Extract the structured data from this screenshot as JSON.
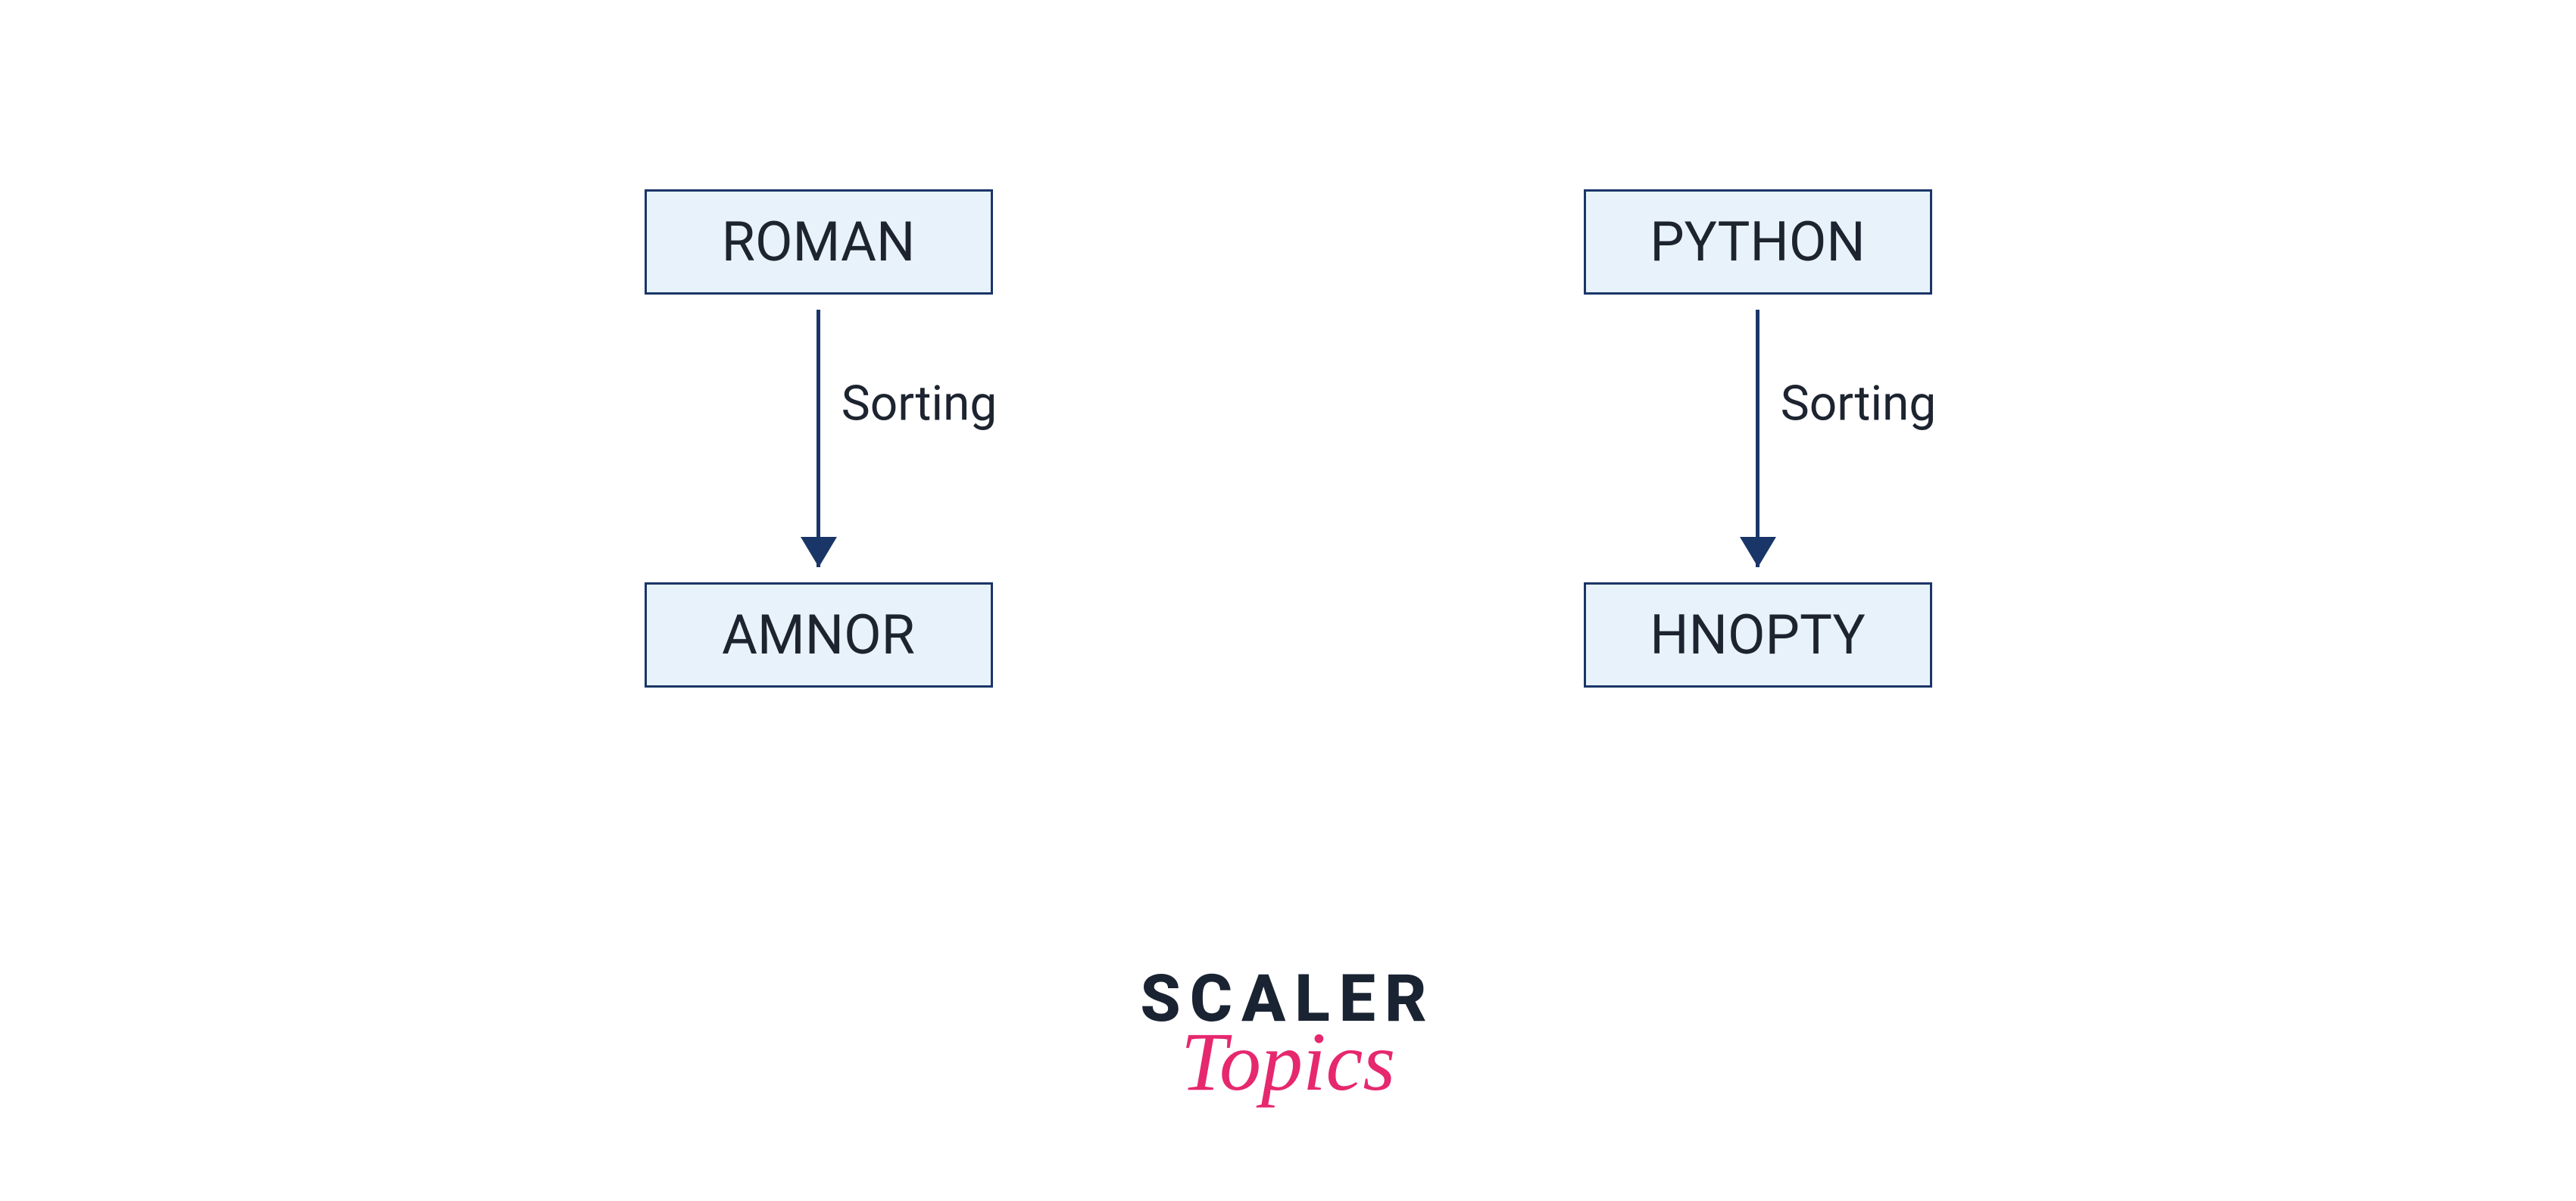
{
  "flows": [
    {
      "input": "ROMAN",
      "label": "Sorting",
      "output": "AMNOR"
    },
    {
      "input": "PYTHON",
      "label": "Sorting",
      "output": "HNOPTY"
    }
  ],
  "logo": {
    "line1": "SCALER",
    "line2": "Topics"
  }
}
